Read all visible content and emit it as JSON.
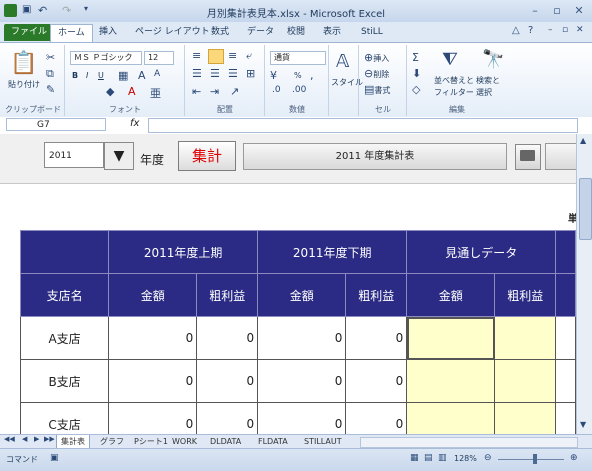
{
  "window": {
    "title": "月別集計表見本.xlsx - Microsoft Excel"
  },
  "tabs": [
    "ファイル",
    "ホーム",
    "挿入",
    "ページ レイアウト",
    "数式",
    "データ",
    "校閲",
    "表示",
    "StiLL"
  ],
  "ribbon": {
    "clipboard": {
      "label": "クリップボード",
      "paste": "貼り付け"
    },
    "font": {
      "label": "フォント",
      "name": "ＭＳ Ｐゴシック",
      "size": "12",
      "bold": "B",
      "italic": "I",
      "underline": "U"
    },
    "align": {
      "label": "配置"
    },
    "number": {
      "label": "数値",
      "format": "通貨",
      "percent": "%"
    },
    "style": {
      "label": "スタイル"
    },
    "cells": {
      "label": "セル",
      "insert": "挿入",
      "delete": "削除",
      "format": "書式"
    },
    "edit": {
      "label": "編集",
      "sort": "並べ替えと",
      "filter": "フィルター",
      "find": "検索と",
      "select": "選択"
    }
  },
  "formula_bar": {
    "name_box": "G7",
    "fx": "fx",
    "value": ""
  },
  "sheet": {
    "year_value": "2011",
    "nendo_label": "年度",
    "shukei_button": "集計",
    "report_button": "2011 年度集計表",
    "unit_label": "単",
    "header_groups": [
      "2011年度上期",
      "2011年度下期",
      "見通しデータ"
    ],
    "header_cols": [
      "支店名",
      "金額",
      "粗利益",
      "金額",
      "粗利益",
      "金額",
      "粗利益"
    ],
    "rows": [
      {
        "name": "A支店",
        "values": [
          "0",
          "0",
          "0",
          "0",
          "",
          ""
        ]
      },
      {
        "name": "B支店",
        "values": [
          "0",
          "0",
          "0",
          "0",
          "",
          ""
        ]
      },
      {
        "name": "C支店",
        "values": [
          "0",
          "0",
          "0",
          "0",
          "",
          ""
        ]
      }
    ]
  },
  "sheet_tabs": [
    "集計表",
    "グラフ",
    "Pシート1",
    "WORK",
    "DLDATA",
    "FLDATA",
    "STILLAUT"
  ],
  "status": {
    "mode": "コマンド",
    "zoom": "128%"
  }
}
